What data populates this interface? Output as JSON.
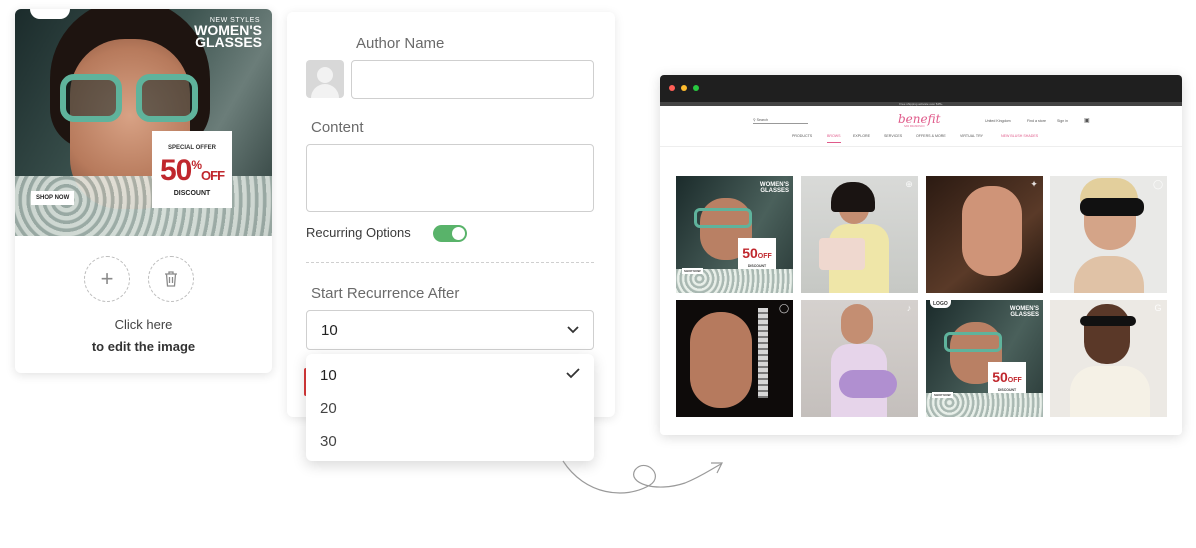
{
  "editor_card": {
    "ad": {
      "kicker": "NEW STYLES",
      "title": "WOMEN'S GLASSES",
      "offer_kicker": "SPECIAL OFFER",
      "offer_big": "50",
      "offer_percent": "%",
      "offer_off": "OFF",
      "offer_discount": "DISCOUNT",
      "cta": "SHOP NOW"
    },
    "add_icon": "plus-icon",
    "delete_icon": "trash-icon",
    "hint_line1": "Click here",
    "hint_line2": "to edit the image"
  },
  "form": {
    "author_label": "Author Name",
    "author_value": "",
    "content_label": "Content",
    "content_value": "",
    "recurring_label": "Recurring Options",
    "recurring_enabled": true,
    "start_label": "Start Recurrence After",
    "start_value": "10",
    "options": [
      "10",
      "20",
      "30"
    ],
    "selected_option": "10",
    "toggle_color": "#59b36a"
  },
  "browser": {
    "shipping_banner": "Free shipping activate over $35+",
    "brand": "benefit",
    "brand_tagline": "SAN FRANCISCO",
    "search_placeholder": "Search",
    "utility": [
      "United Kingdom",
      "Find a store",
      "Sign in"
    ],
    "nav": [
      "PRODUCTS",
      "BROWS",
      "EXPLORE",
      "SERVICES",
      "OFFERS & MORE",
      "VIRTUAL TRY",
      "NEW BLUSH SHADES"
    ],
    "tiles": [
      {
        "type": "ad",
        "icon": "logo-badge"
      },
      {
        "type": "photo",
        "icon": "plus-circle-icon"
      },
      {
        "type": "photo",
        "icon": "twitter-icon"
      },
      {
        "type": "photo",
        "icon": "instagram-icon"
      },
      {
        "type": "photo",
        "icon": "instagram-icon"
      },
      {
        "type": "photo",
        "icon": "tiktok-icon"
      },
      {
        "type": "ad",
        "icon": "logo-badge"
      },
      {
        "type": "photo",
        "icon": "google-icon"
      }
    ],
    "tile_ad": {
      "kicker": "NEW STYLES",
      "title": "WOMEN'S GLASSES",
      "offer_kicker": "SPECIAL OFFER",
      "offer_big": "50",
      "offer_off": "OFF",
      "offer_discount": "DISCOUNT",
      "cta": "SHOP NOW",
      "logo": "LOGO"
    }
  },
  "colors": {
    "accent_red": "#c0272d",
    "brand_pink": "#e05a8a",
    "toggle_green": "#59b36a"
  }
}
